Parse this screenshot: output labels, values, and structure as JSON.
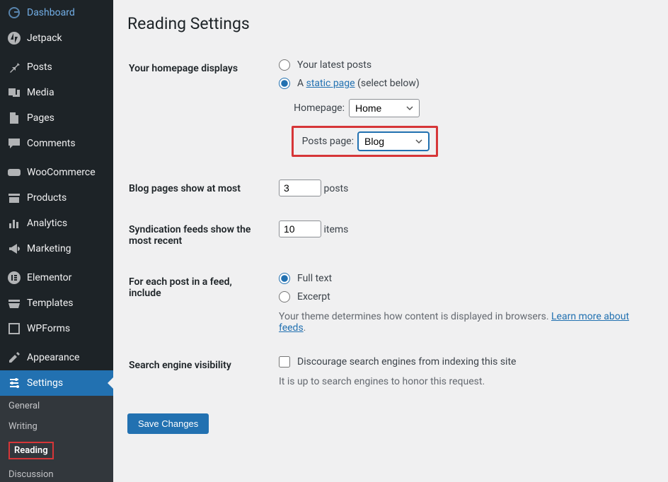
{
  "sidebar": {
    "items": [
      {
        "label": "Dashboard",
        "icon": "dashboard"
      },
      {
        "label": "Jetpack",
        "icon": "jetpack"
      },
      {
        "label": "Posts",
        "icon": "pin"
      },
      {
        "label": "Media",
        "icon": "media"
      },
      {
        "label": "Pages",
        "icon": "pages"
      },
      {
        "label": "Comments",
        "icon": "comments"
      },
      {
        "label": "WooCommerce",
        "icon": "woo"
      },
      {
        "label": "Products",
        "icon": "products"
      },
      {
        "label": "Analytics",
        "icon": "analytics"
      },
      {
        "label": "Marketing",
        "icon": "marketing"
      },
      {
        "label": "Elementor",
        "icon": "elementor"
      },
      {
        "label": "Templates",
        "icon": "templates"
      },
      {
        "label": "WPForms",
        "icon": "wpforms"
      },
      {
        "label": "Appearance",
        "icon": "appearance"
      },
      {
        "label": "Settings",
        "icon": "settings"
      }
    ],
    "sub": [
      {
        "label": "General"
      },
      {
        "label": "Writing"
      },
      {
        "label": "Reading"
      },
      {
        "label": "Discussion"
      }
    ]
  },
  "page": {
    "title": "Reading Settings",
    "homepage_displays_label": "Your homepage displays",
    "opt_latest": "Your latest posts",
    "opt_static_prefix": "A ",
    "opt_static_link": "static page",
    "opt_static_suffix": " (select below)",
    "homepage_label": "Homepage:",
    "homepage_value": "Home",
    "postspage_label": "Posts page:",
    "postspage_value": "Blog",
    "blogpages_label": "Blog pages show at most",
    "blogpages_value": "3",
    "blogpages_unit": "posts",
    "syndication_label": "Syndication feeds show the most recent",
    "syndication_value": "10",
    "syndication_unit": "items",
    "feed_include_label": "For each post in a feed, include",
    "feed_full": "Full text",
    "feed_excerpt": "Excerpt",
    "feed_desc_prefix": "Your theme determines how content is displayed in browsers. ",
    "feed_desc_link": "Learn more about feeds",
    "feed_desc_suffix": ".",
    "search_label": "Search engine visibility",
    "search_checkbox": "Discourage search engines from indexing this site",
    "search_desc": "It is up to search engines to honor this request.",
    "save_btn": "Save Changes"
  }
}
